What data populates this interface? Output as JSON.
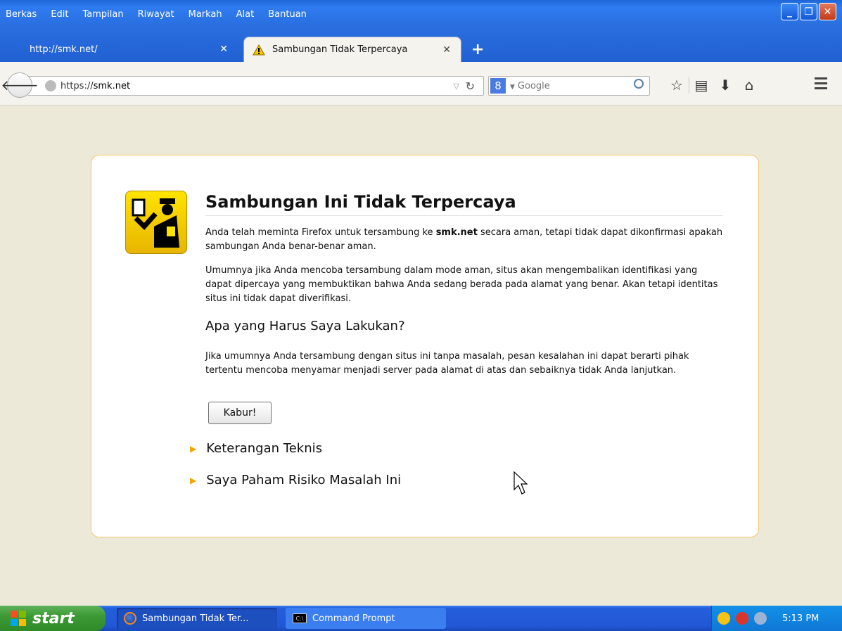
{
  "menu": [
    "Berkas",
    "Edit",
    "Tampilan",
    "Riwayat",
    "Markah",
    "Alat",
    "Bantuan"
  ],
  "tabs": [
    {
      "title": "http://smk.net/",
      "close": "✕",
      "active": false
    },
    {
      "title": "Sambungan Tidak Terpercaya",
      "close": "✕",
      "active": true
    }
  ],
  "new_tab": "+",
  "navbar": {
    "url_prefix": "https://",
    "url_host": "smk.net",
    "search_placeholder": "Google",
    "search_engine_letter": "8"
  },
  "page": {
    "heading": "Sambungan Ini Tidak Terpercaya",
    "p1_before": "Anda telah meminta Firefox untuk tersambung ke ",
    "p1_host": "smk.net",
    "p1_after": " secara aman, tetapi tidak dapat dikonfirmasi apakah sambungan Anda benar-benar aman.",
    "p2": "Umumnya jika Anda mencoba tersambung dalam mode aman, situs akan mengembalikan identifikasi yang dapat dipercaya yang membuktikan bahwa Anda sedang berada pada alamat yang benar. Akan tetapi identitas situs ini tidak dapat diverifikasi.",
    "subheading": "Apa yang Harus Saya Lakukan?",
    "p3": "Jika umumnya Anda tersambung dengan situs ini tanpa masalah, pesan kesalahan ini dapat berarti pihak tertentu mencoba menyamar menjadi server pada alamat di atas dan sebaiknya tidak Anda lanjutkan.",
    "escape_button": "Kabur!",
    "expander_technical": "Keterangan Teknis",
    "expander_risk": "Saya Paham Risiko Masalah Ini"
  },
  "taskbar": {
    "start": "start",
    "items": [
      "Sambungan Tidak Ter...",
      "Command Prompt"
    ],
    "clock": "5:13 PM"
  },
  "icons": [
    "minimize-icon",
    "maximize-icon",
    "close-icon",
    "warning-icon",
    "back-icon",
    "globe-icon",
    "reload-icon",
    "search-icon",
    "bookmark-star-icon",
    "reading-list-icon",
    "download-icon",
    "home-icon",
    "hamburger-menu-icon",
    "certificate-officer-icon",
    "windows-logo-icon",
    "firefox-icon",
    "cmd-icon"
  ],
  "colors": {
    "xp_blue": "#2a6fe0",
    "error_border": "#f5c96d",
    "page_bg": "#ece9d8",
    "start_green": "#3c9a35"
  }
}
